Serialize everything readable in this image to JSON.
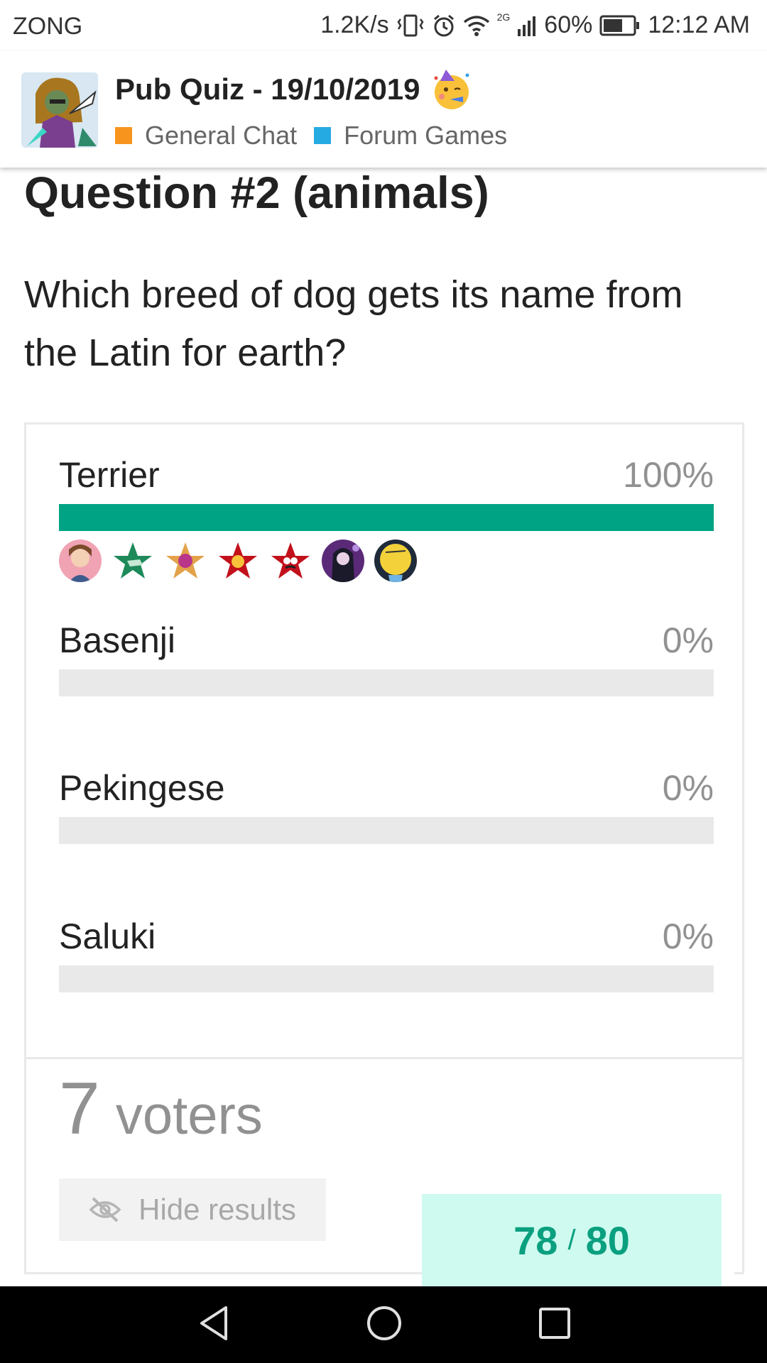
{
  "status_bar": {
    "carrier": "ZONG",
    "speed": "1.2K/s",
    "network": "2G",
    "battery": "60%",
    "time": "12:12 AM"
  },
  "header": {
    "title": "Pub Quiz - 19/10/2019",
    "categories": [
      {
        "label": "General Chat",
        "color": "#f7941d"
      },
      {
        "label": "Forum Games",
        "color": "#25aae2"
      }
    ]
  },
  "post": {
    "heading": "Question #2 (animals)",
    "question": "Which breed of dog gets its name from the Latin for earth?"
  },
  "poll": {
    "options": [
      {
        "label": "Terrier",
        "percent": "100%",
        "fill": 1.0
      },
      {
        "label": "Basenji",
        "percent": "0%",
        "fill": 0
      },
      {
        "label": "Pekingese",
        "percent": "0%",
        "fill": 0
      },
      {
        "label": "Saluki",
        "percent": "0%",
        "fill": 0
      }
    ],
    "voter_count": "7",
    "voter_label": "voters",
    "hide_results_label": "Hide results"
  },
  "progress": {
    "current": "78",
    "separator": "/",
    "total": "80"
  },
  "colors": {
    "accent": "#00a383",
    "progress_bg": "#cffaf0"
  }
}
